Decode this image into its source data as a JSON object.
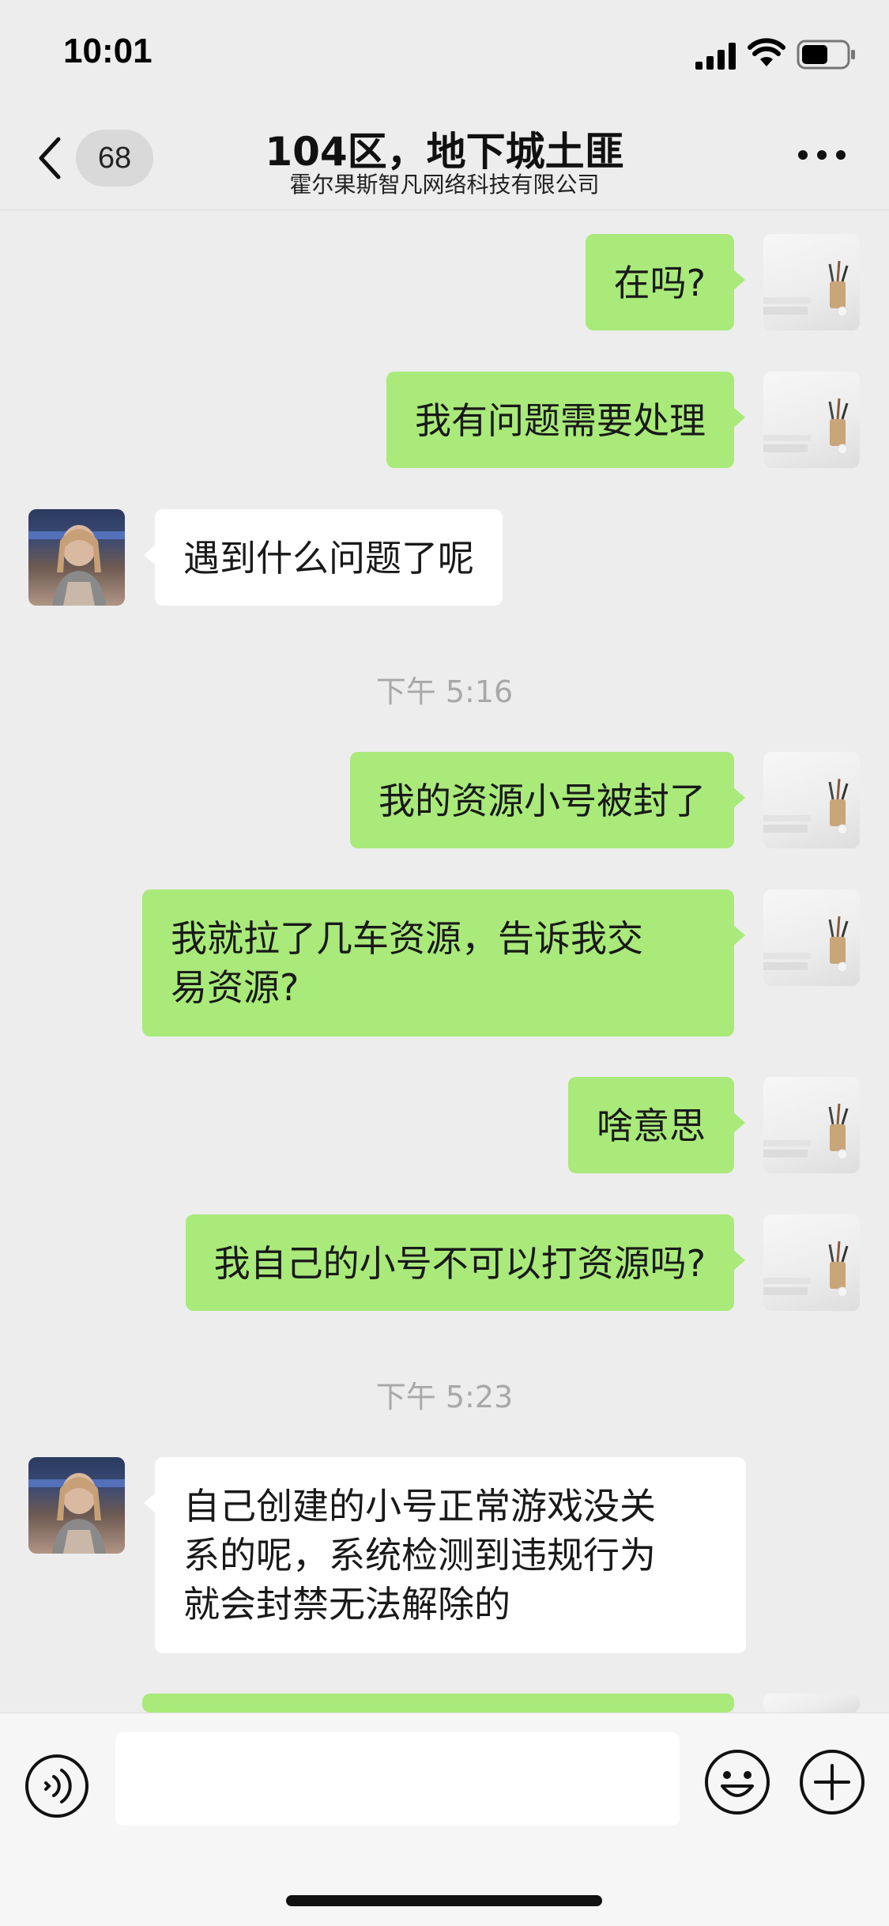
{
  "status_bar": {
    "time": "10:01",
    "icons": [
      "signal-icon",
      "wifi-icon",
      "battery-icon"
    ]
  },
  "nav": {
    "back_icon": "chevron-left-icon",
    "unread_count": "68",
    "title": "104区，地下城土匪",
    "subtitle": "霍尔果斯智凡网络科技有限公司",
    "more_icon": "more-icon"
  },
  "messages": [
    {
      "sender": "me",
      "text": "在吗?"
    },
    {
      "sender": "me",
      "text": "我有问题需要处理"
    },
    {
      "sender": "other",
      "text": "遇到什么问题了呢"
    },
    {
      "type": "timestamp",
      "text": "下午 5:16"
    },
    {
      "sender": "me",
      "text": "我的资源小号被封了"
    },
    {
      "sender": "me",
      "lines": [
        "我就拉了几车资源，告诉我交",
        "易资源?"
      ]
    },
    {
      "sender": "me",
      "text": "啥意思"
    },
    {
      "sender": "me",
      "text": "我自己的小号不可以打资源吗?"
    },
    {
      "type": "timestamp",
      "text": "下午 5:23"
    },
    {
      "sender": "other",
      "lines": [
        "自己创建的小号正常游戏没关",
        "系的呢，系统检测到违规行为",
        "就会封禁无法解除的"
      ]
    },
    {
      "sender": "me",
      "text": "",
      "partially_visible": true
    }
  ],
  "input_bar": {
    "voice_icon": "voice-icon",
    "input_value": "",
    "emoji_icon": "emoji-icon",
    "plus_icon": "plus-icon"
  },
  "colors": {
    "background": "#ededed",
    "my_bubble": "#a9ea7a",
    "other_bubble": "#ffffff",
    "timestamp": "#a8a8a8"
  }
}
